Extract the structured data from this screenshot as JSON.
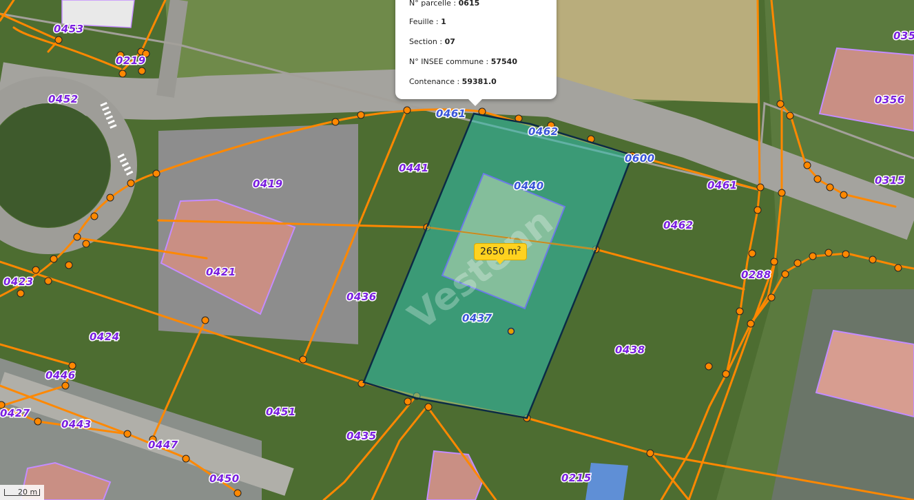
{
  "popup": {
    "rows": [
      {
        "label": "N° parcelle :",
        "value": "0615"
      },
      {
        "label": "Feuille :",
        "value": "1"
      },
      {
        "label": "Section :",
        "value": "07"
      },
      {
        "label": "N° INSEE commune :",
        "value": "57540"
      },
      {
        "label": "Contenance :",
        "value": "59381.0"
      }
    ]
  },
  "selection": {
    "area_value": "2650 m",
    "area_exponent": "2",
    "watermark": "Vestenn"
  },
  "parcels": {
    "purple": [
      "0453",
      "0219",
      "0452",
      "0419",
      "0441",
      "0421",
      "0423",
      "0424",
      "0436",
      "0446",
      "0427",
      "0443",
      "0451",
      "0447",
      "0435",
      "0450",
      "0215",
      "0438",
      "0462",
      "0461",
      "0288",
      "0356",
      "0315",
      "035"
    ],
    "blue": [
      "0461",
      "0462",
      "0600",
      "0440",
      "0437"
    ]
  },
  "scale": {
    "label": "20 m"
  },
  "colors": {
    "parcel_line": "#ff8800",
    "parcel_label": "#7a1fe0",
    "parcel_label_alt": "#3a55d9",
    "selection_fill": "#2dbfae",
    "selection_stroke": "#0b2b45",
    "building_fill": "#c98f84",
    "building_outline": "#c48cff",
    "badge": "#ffd21f"
  }
}
